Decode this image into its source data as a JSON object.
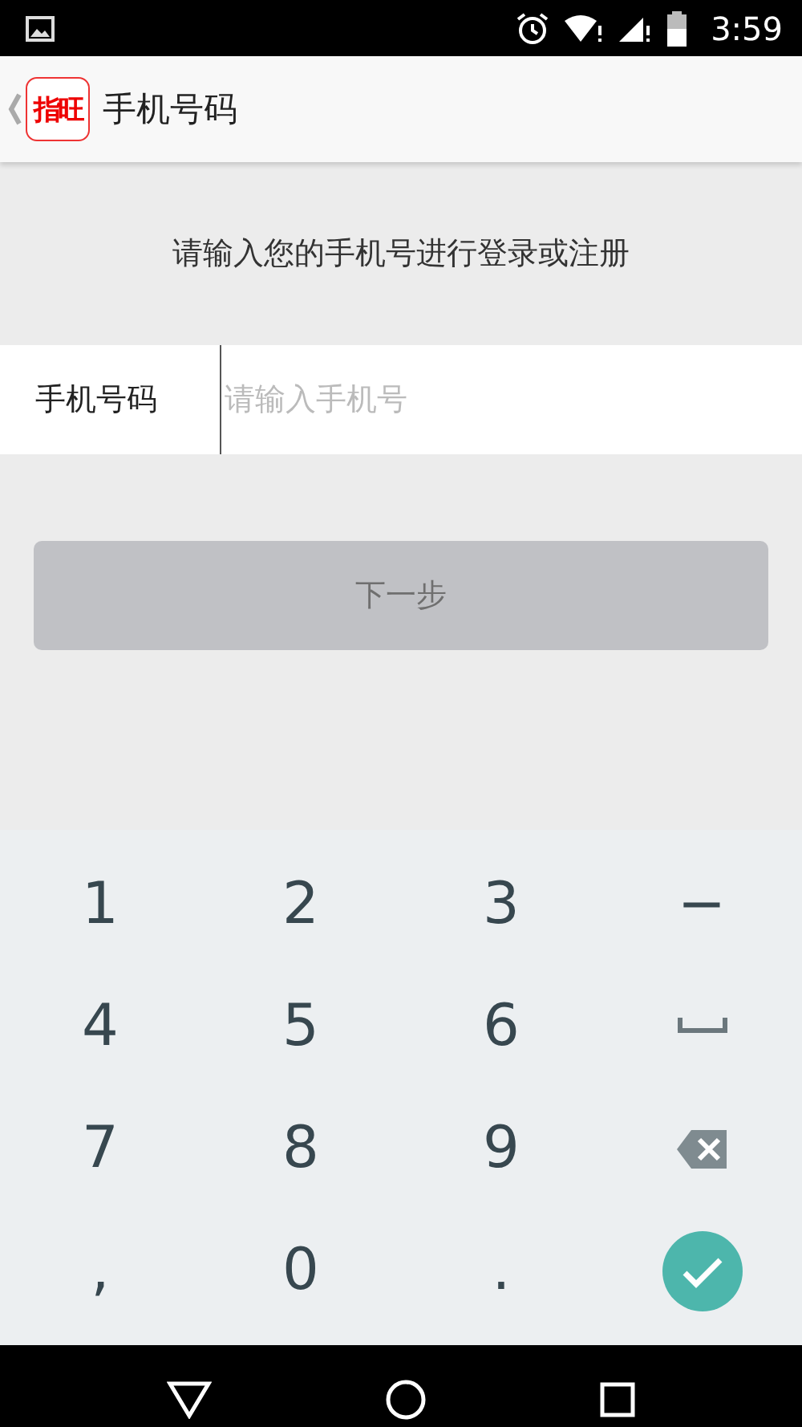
{
  "status_bar": {
    "time": "3:59"
  },
  "app_bar": {
    "logo": "指旺",
    "title": "手机号码"
  },
  "prompt": "请输入您的手机号进行登录或注册",
  "phone_field": {
    "label": "手机号码",
    "placeholder": "请输入手机号"
  },
  "next_button": {
    "label": "下一步",
    "disabled": true
  },
  "keypad": [
    {
      "kind": "char",
      "label": "1"
    },
    {
      "kind": "char",
      "label": "2"
    },
    {
      "kind": "char",
      "label": "3"
    },
    {
      "kind": "char",
      "label": "−"
    },
    {
      "kind": "char",
      "label": "4"
    },
    {
      "kind": "char",
      "label": "5"
    },
    {
      "kind": "char",
      "label": "6"
    },
    {
      "kind": "space"
    },
    {
      "kind": "char",
      "label": "7"
    },
    {
      "kind": "char",
      "label": "8"
    },
    {
      "kind": "char",
      "label": "9"
    },
    {
      "kind": "backspace"
    },
    {
      "kind": "char",
      "label": ","
    },
    {
      "kind": "char",
      "label": "0"
    },
    {
      "kind": "char",
      "label": "."
    },
    {
      "kind": "done"
    }
  ]
}
